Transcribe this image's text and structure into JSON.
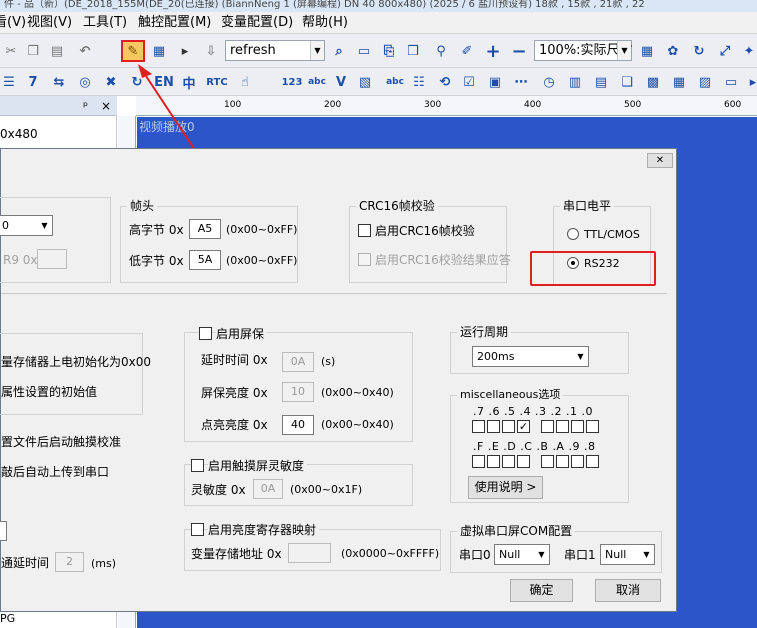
{
  "title_strip": "件 - 品（新）(DE_2018_155M(DE_20(已连接)  (BiannNeng 1 (屏幕编程) DN 40 800x480)  (2025 / 6 盐川预设有) 18款 , 15款 , 21款 , 22",
  "menu": [
    "看(V)",
    "视图(V)",
    "工具(T)",
    "触控配置(M)",
    "变量配置(D)",
    "帮助(H)"
  ],
  "toolbar": {
    "command_value": "refresh",
    "zoom_value": "100%:实际尺寸"
  },
  "toolbar2_labels": [
    "EN",
    "中",
    "RTC",
    "123",
    "abc",
    "abc"
  ],
  "left_panel": {
    "pin": "ᵖ",
    "close": "×",
    "item": "0x480"
  },
  "ruler_labels": [
    "100",
    "200",
    "300",
    "400",
    "500",
    "600"
  ],
  "canvas_label": "视频播放0",
  "dialog": {
    "close_label": "✕",
    "left_group": {
      "combo_value": "0",
      "r9_label": "R9 0x"
    },
    "frame_head": {
      "title": "帧头",
      "high_label": "高字节 0x",
      "high_value": "A5",
      "high_range": "(0x00~0xFF)",
      "low_label": "低字节 0x",
      "low_value": "5A",
      "low_range": "(0x00~0xFF)"
    },
    "crc": {
      "title": "CRC16帧校验",
      "enable_label": "启用CRC16帧校验",
      "ack_label": "启用CRC16校验结果应答"
    },
    "serial_level": {
      "title": "串口电平",
      "ttl_label": "TTL/CMOS",
      "rs232_label": "RS232",
      "selected": "RS232",
      "highlight_color": "#e02020"
    },
    "init_group": {
      "line1": "量存储器上电初始化为0x00",
      "line2": "属性设置的初始值"
    },
    "screensaver": {
      "title": "启用屏保",
      "delay_label": "延时时间  0x",
      "delay_value": "0A",
      "delay_unit": "(s)",
      "bright_label": "屏保亮度  0x",
      "bright_value": "10",
      "bright_range": "(0x00~0x40)",
      "on_label": "点亮亮度  0x",
      "on_value": "40",
      "on_range": "(0x00~0x40)"
    },
    "run_period": {
      "title": "运行周期",
      "value": "200ms"
    },
    "misc": {
      "title": "miscellaneous选项",
      "top_bits": ".7 .6 .5 .4   .3 .2 .1 .0",
      "bottom_bits": ".F .E .D .C   .B .A .9 .8",
      "top_checked": [
        false,
        false,
        false,
        true,
        false,
        false,
        false,
        false
      ],
      "bottom_checked": [
        false,
        false,
        false,
        false,
        false,
        false,
        false,
        false
      ],
      "help_button": "使用说明 >"
    },
    "left_lines": {
      "line1": "置文件后启动触摸校准",
      "line2": "敲后自动上传到串口"
    },
    "touch_sens": {
      "title": "启用触摸屏灵敏度",
      "label": "灵敏度  0x",
      "value": "0A",
      "range": "(0x00~0x1F)"
    },
    "brightness_map": {
      "title": "启用亮度寄存器映射",
      "addr_label": "变量存储地址  0x",
      "addr_value": "",
      "addr_range": "(0x0000~0xFFFF)"
    },
    "delay_row": {
      "label": "通延时间",
      "value": "2",
      "unit": "(ms)"
    },
    "virtual_com": {
      "title": "虚拟串口屏COM配置",
      "port0_label": "串口0",
      "port0_value": "Null",
      "port1_label": "串口1",
      "port1_value": "Null"
    },
    "ok_button": "确定",
    "cancel_button": "取消",
    "bottom_fragment": "PG"
  }
}
